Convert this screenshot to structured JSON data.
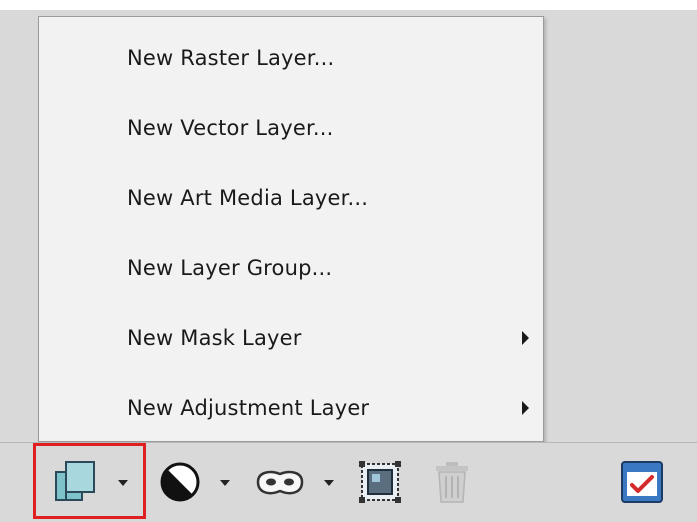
{
  "menu": {
    "items": [
      {
        "label": "New Raster Layer...",
        "submenu": false
      },
      {
        "label": "New Vector Layer...",
        "submenu": false
      },
      {
        "label": "New Art Media Layer...",
        "submenu": false
      },
      {
        "label": "New Layer Group...",
        "submenu": false
      },
      {
        "label": "New Mask Layer",
        "submenu": true
      },
      {
        "label": "New Adjustment Layer",
        "submenu": true
      }
    ]
  },
  "toolbar": {
    "buttons": [
      {
        "icon": "new-layer-icon",
        "has_dropdown": true,
        "highlighted": true
      },
      {
        "icon": "adjustment-contrast-icon",
        "has_dropdown": true
      },
      {
        "icon": "mask-icon",
        "has_dropdown": true
      },
      {
        "icon": "layer-frame-icon",
        "has_dropdown": false
      },
      {
        "icon": "trash-icon",
        "has_dropdown": false,
        "disabled": true
      },
      {
        "icon": "layer-properties-icon",
        "has_dropdown": false
      }
    ]
  },
  "colors": {
    "menu_bg": "#f2f2f2",
    "toolbar_bg": "#d9d9d9",
    "highlight": "#e02020",
    "text": "#1a1a1a"
  }
}
